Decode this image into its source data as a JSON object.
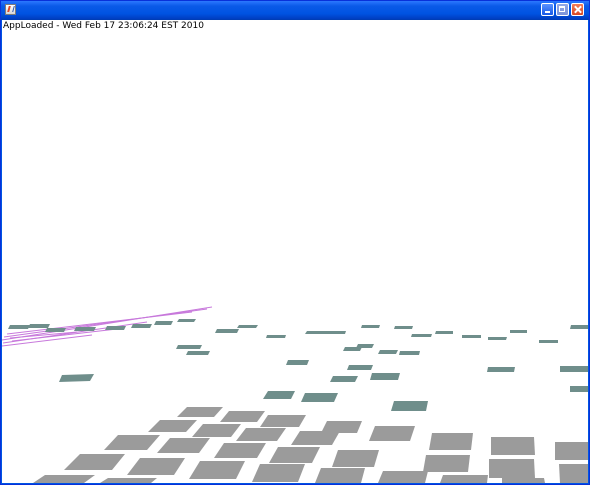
{
  "window": {
    "title": "",
    "icon": "java-cup-icon"
  },
  "content": {
    "status": "AppLoaded - Wed Feb 17 23:06:24 EST 2010"
  },
  "scene": {
    "background": "#ffffff",
    "near_tile_color": "#9b9b9b",
    "far_tile_color": "#6f8e8b",
    "line_cluster_color": "#c26bd8"
  }
}
